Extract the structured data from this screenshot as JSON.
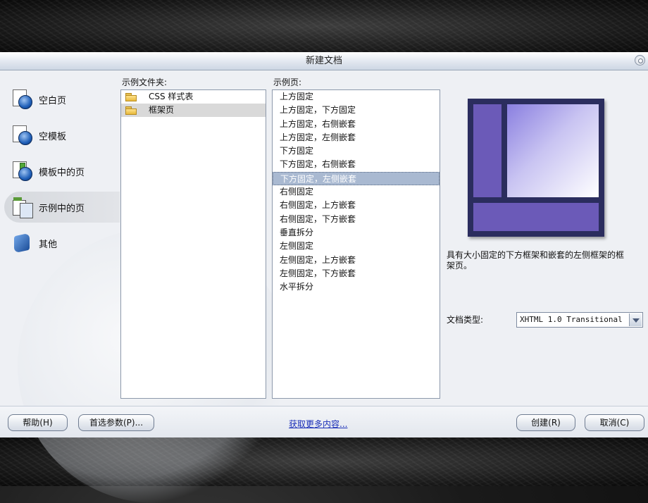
{
  "window": {
    "title": "新建文档"
  },
  "categories": [
    {
      "label": "空白页",
      "icon": "blank-page-icon",
      "selected": false
    },
    {
      "label": "空模板",
      "icon": "blank-template-icon",
      "selected": false
    },
    {
      "label": "模板中的页",
      "icon": "page-from-template-icon",
      "selected": false
    },
    {
      "label": "示例中的页",
      "icon": "page-from-sample-icon",
      "selected": true
    },
    {
      "label": "其他",
      "icon": "other-icon",
      "selected": false
    }
  ],
  "sample_folders": {
    "label": "示例文件夹:",
    "items": [
      {
        "label": "CSS 样式表",
        "selected": false
      },
      {
        "label": "框架页",
        "selected": true
      }
    ]
  },
  "sample_pages": {
    "label": "示例页:",
    "items": [
      "上方固定",
      "上方固定，下方固定",
      "上方固定，右侧嵌套",
      "上方固定，左侧嵌套",
      "下方固定",
      "下方固定，右侧嵌套",
      "下方固定，左侧嵌套",
      "右侧固定",
      "右侧固定，上方嵌套",
      "右侧固定，下方嵌套",
      "垂直拆分",
      "左侧固定",
      "左侧固定，上方嵌套",
      "左侧固定，下方嵌套",
      "水平拆分"
    ],
    "selected_index": 6
  },
  "preview": {
    "description": "具有大小固定的下方框架和嵌套的左侧框架的框架页。",
    "colors": {
      "frame": "#2b2d5e",
      "panel": "#6b5ab8",
      "highlight": "#c9c4f2"
    }
  },
  "doctype": {
    "label": "文档类型:",
    "value": "XHTML 1.0 Transitional"
  },
  "buttons": {
    "help": "帮助(H)",
    "preferences": "首选参数(P)...",
    "more_content": "获取更多内容...",
    "create": "创建(R)",
    "cancel": "取消(C)"
  }
}
